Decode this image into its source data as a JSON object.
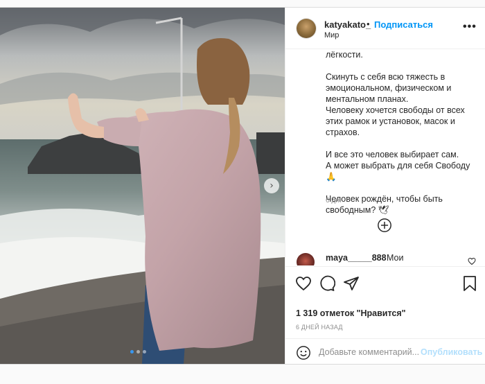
{
  "post": {
    "username": "katyakato_",
    "separator": "•",
    "follow_label": "Подписаться",
    "location": "Мир",
    "more_label": "•••",
    "caption": "лёгкости.\n\nСкинуть с себя всю тяжесть в эмоциональном, физическом и ментальном планах.\nЧеловеку хочется свободы от всех этих рамок и установок, масок и страхов.\n\nИ все это человек выбирает сам.\nА может выбрать для себя Свободу 🙏\n\nЧеловек рождён, чтобы быть свободным? 🕊",
    "timestamp": "6 дн.",
    "comment": {
      "user": "maya_____888",
      "text": "Мои"
    },
    "likes": "1 319 отметок \"Нравится\"",
    "date": "6 ДНЕЙ НАЗАД",
    "comment_placeholder": "Добавьте комментарий...",
    "publish_label": "Опубликовать",
    "carousel": {
      "slides": 3,
      "active": 0,
      "next_label": "›"
    }
  },
  "colors": {
    "accent": "#0095f6",
    "publish_disabled": "#b2dffc",
    "active_dot": "#3897f0"
  },
  "icons": [
    "heart-icon",
    "comment-icon",
    "share-icon",
    "bookmark-icon",
    "emoji-icon",
    "plus-circle-icon",
    "more-icon"
  ]
}
